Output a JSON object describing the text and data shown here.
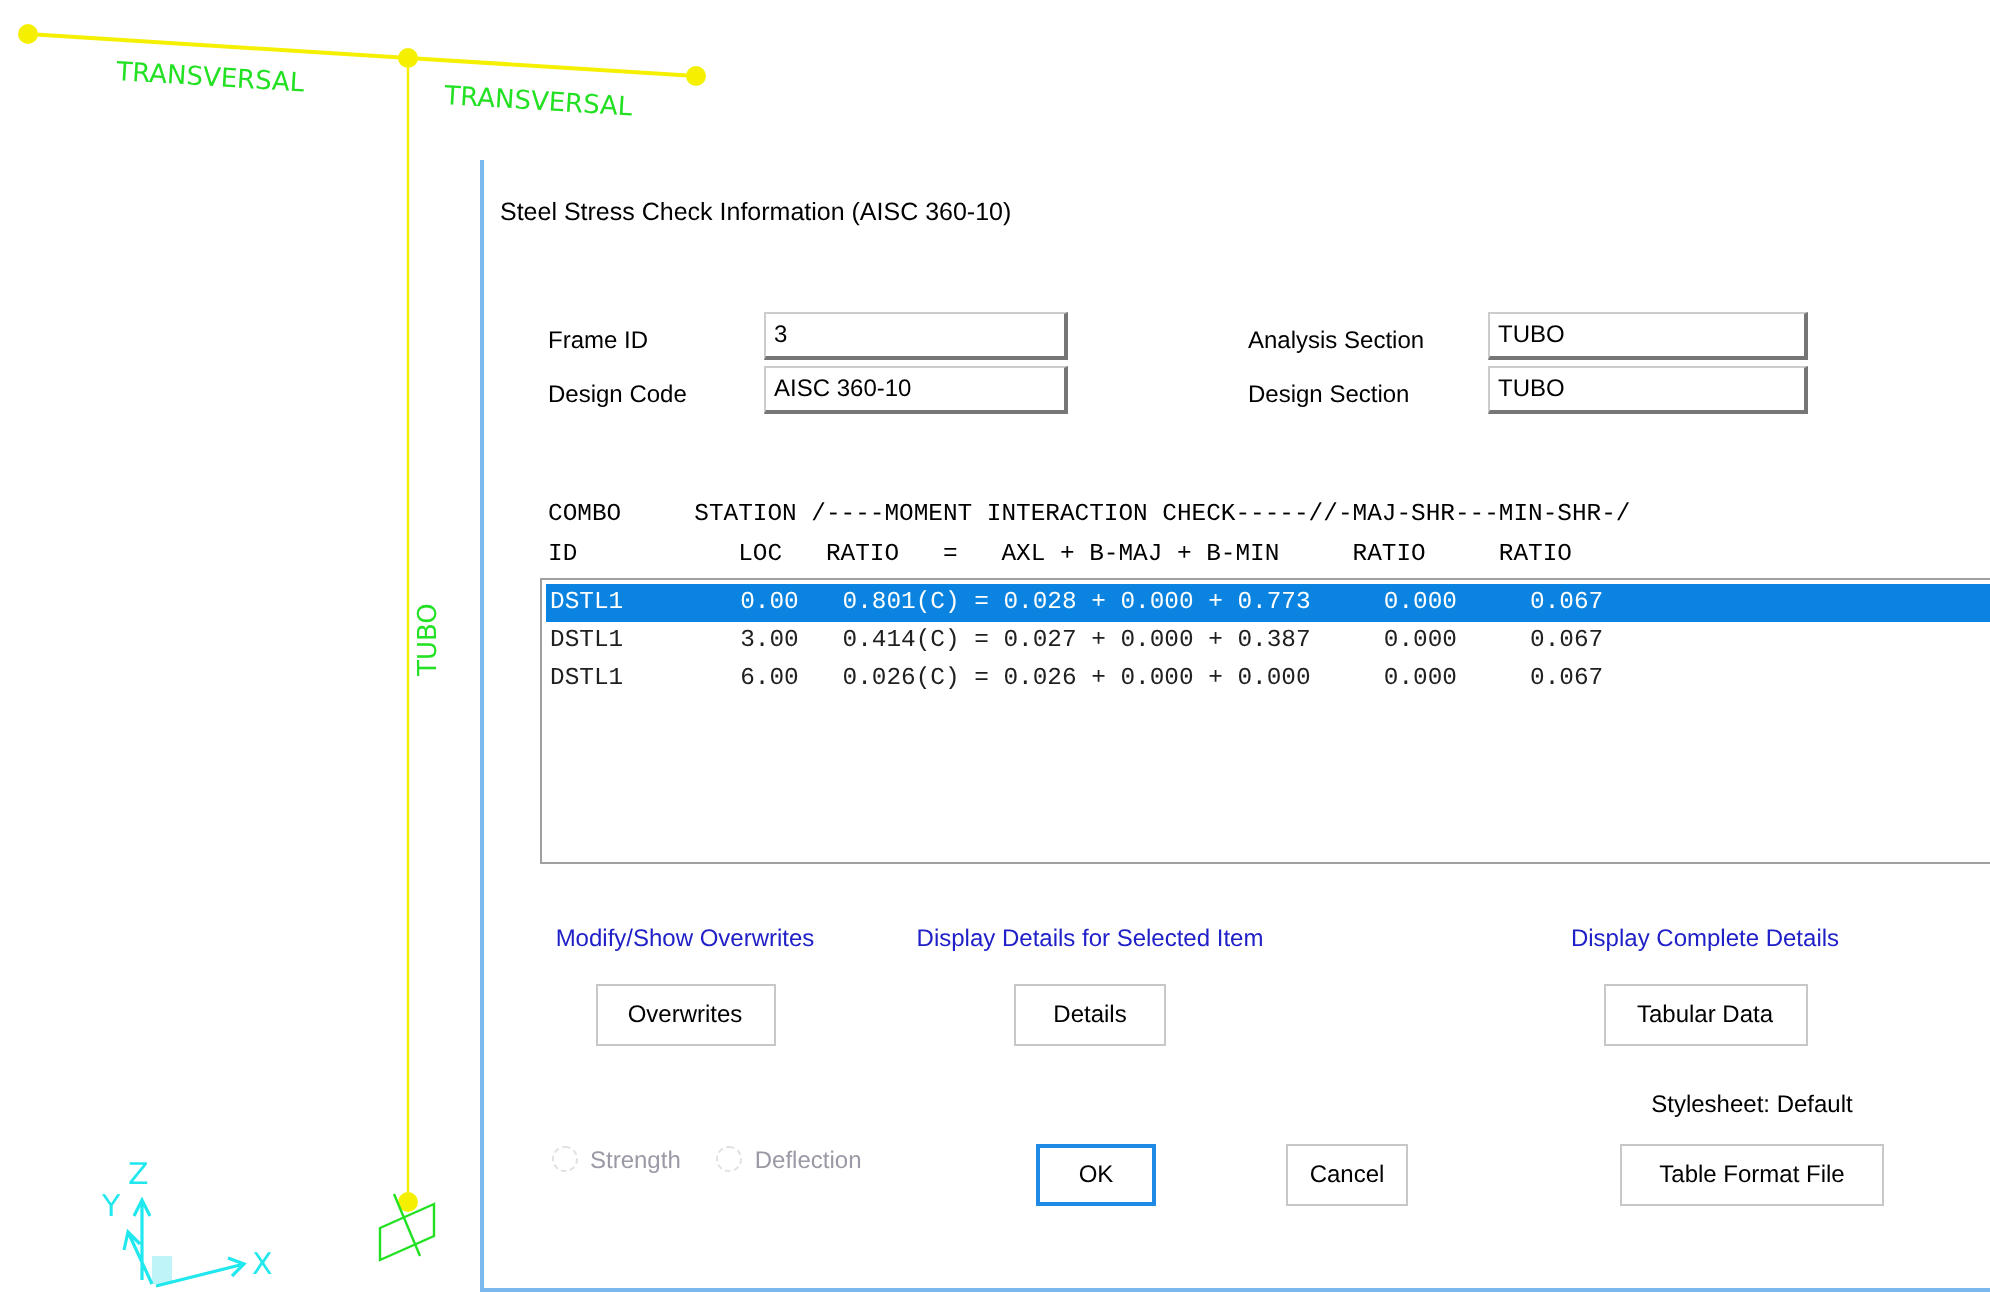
{
  "canvas": {
    "beam_labels": [
      "TRANSVERSAL",
      "TRANSVERSAL"
    ],
    "column_label": "TUBO",
    "axes": {
      "x": "X",
      "y": "Y",
      "z": "Z"
    }
  },
  "dialog": {
    "title": "Steel Stress Check Information (AISC 360-10)",
    "fields": [
      {
        "label": "Frame ID",
        "value": "3"
      },
      {
        "label": "Analysis Section",
        "value": "TUBO"
      },
      {
        "label": "Design Code",
        "value": "AISC 360-10"
      },
      {
        "label": "Design Section",
        "value": "TUBO"
      }
    ],
    "listing": {
      "header": [
        "COMBO     STATION /----MOMENT INTERACTION CHECK-----//-MAJ-SHR---MIN-SHR-/",
        "ID           LOC   RATIO   =   AXL + B-MAJ + B-MIN     RATIO     RATIO"
      ],
      "rows": [
        {
          "text": "DSTL1        0.00   0.801(C) = 0.028 + 0.000 + 0.773     0.000     0.067",
          "selected": true
        },
        {
          "text": "DSTL1        3.00   0.414(C) = 0.027 + 0.000 + 0.387     0.000     0.067",
          "selected": false
        },
        {
          "text": "DSTL1        6.00   0.026(C) = 0.026 + 0.000 + 0.000     0.000     0.067",
          "selected": false
        }
      ]
    },
    "actions": [
      {
        "caption": "Modify/Show Overwrites",
        "button": "Overwrites"
      },
      {
        "caption": "Display Details for Selected Item",
        "button": "Details"
      },
      {
        "caption": "Display Complete Details",
        "button": "Tabular Data"
      }
    ],
    "options": [
      {
        "label": "Strength",
        "selected": false,
        "disabled": true
      },
      {
        "label": "Deflection",
        "selected": false,
        "disabled": true
      }
    ],
    "stylesheet": "Stylesheet: Default",
    "buttons": [
      {
        "label": "OK",
        "default": true
      },
      {
        "label": "Cancel",
        "default": false
      },
      {
        "label": "Table Format File",
        "default": false
      }
    ]
  }
}
